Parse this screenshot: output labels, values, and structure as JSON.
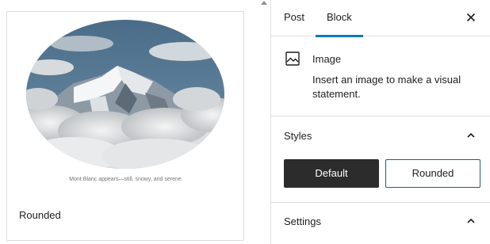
{
  "preview": {
    "caption": "Mont Blanc appears—still, snowy, and serene.",
    "style_name": "Rounded"
  },
  "sidebar": {
    "tabs": [
      {
        "label": "Post",
        "active": false
      },
      {
        "label": "Block",
        "active": true
      }
    ],
    "close_icon": "close-icon",
    "block": {
      "icon": "image-icon",
      "title": "Image",
      "description": "Insert an image to make a visual statement."
    },
    "styles_panel": {
      "label": "Styles",
      "expanded": true,
      "options": [
        {
          "label": "Default",
          "selected": true
        },
        {
          "label": "Rounded",
          "selected": false
        }
      ]
    },
    "settings_panel": {
      "label": "Settings",
      "expanded": true
    }
  },
  "colors": {
    "accent": "#007cba",
    "selected_button": "#2c2c2c",
    "outlined_button_border": "#1e5f7a"
  }
}
